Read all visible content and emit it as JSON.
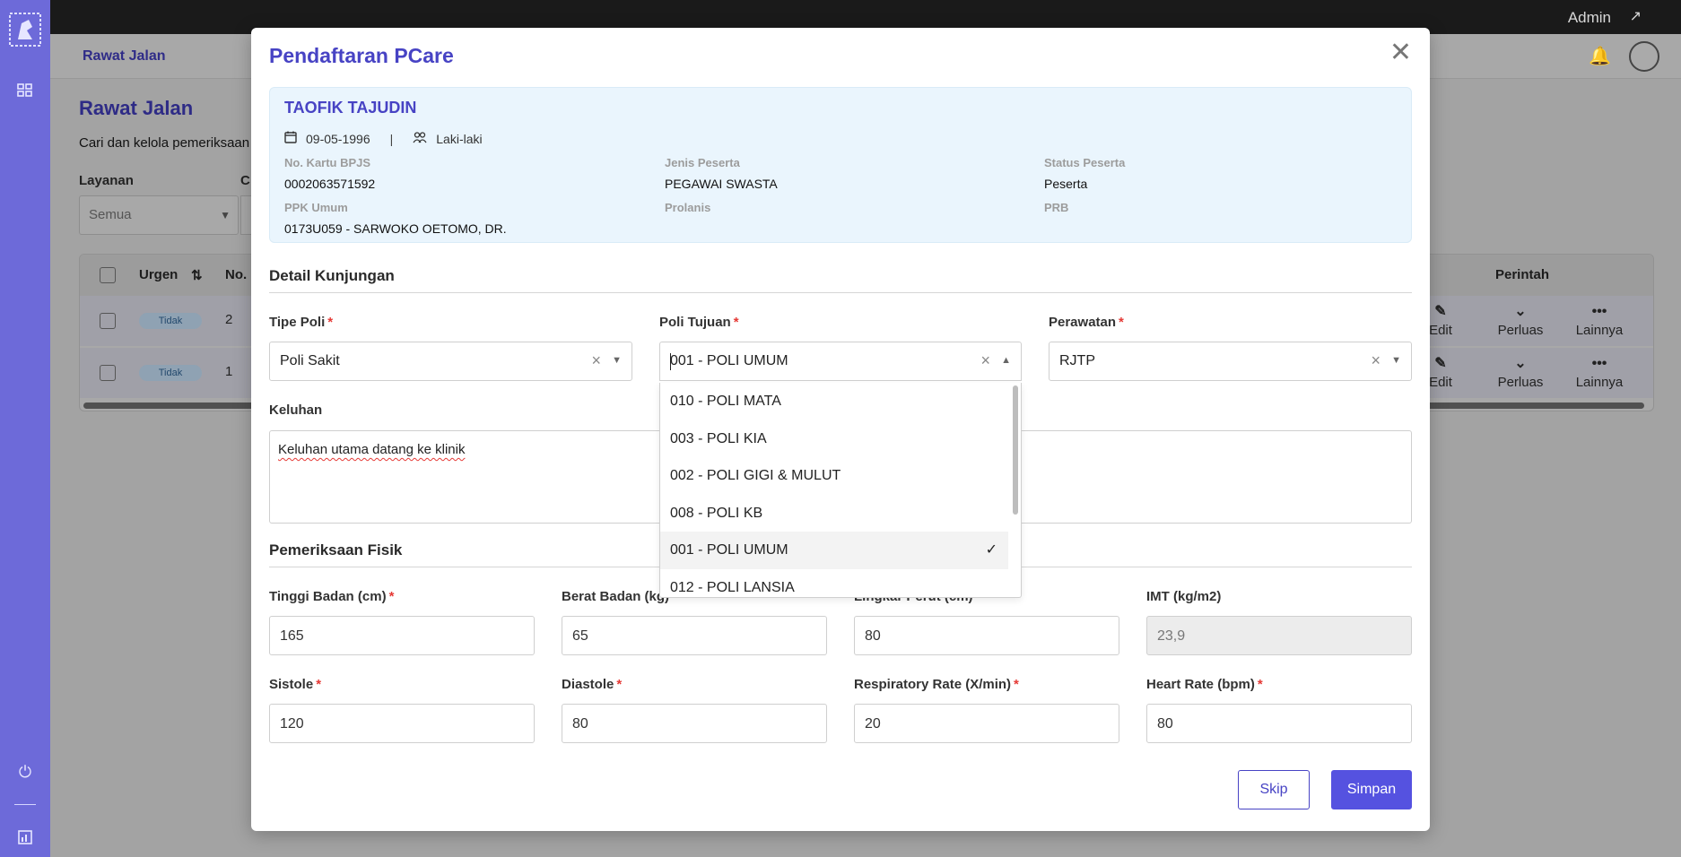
{
  "topbar": {
    "user_label": "Admin"
  },
  "background": {
    "breadcrumb": "Rawat Jalan",
    "page_title": "Rawat Jalan",
    "page_subtitle": "Cari dan kelola pemeriksaan",
    "filter_layanan_label": "Layanan",
    "filter_layanan_value": "Semua",
    "filter_c_label": "C",
    "table": {
      "headers": {
        "urgen": "Urgen",
        "no": "No.",
        "perintah": "Perintah"
      },
      "rows": [
        {
          "urgen": "Tidak",
          "no": "2"
        },
        {
          "urgen": "Tidak",
          "no": "1"
        }
      ],
      "actions": {
        "edit": "Edit",
        "perluas": "Perluas",
        "lainnya": "Lainnya"
      }
    }
  },
  "modal": {
    "title": "Pendaftaran PCare",
    "patient": {
      "name": "TAOFIK TAJUDIN",
      "dob": "09-05-1996",
      "separator": "|",
      "gender": "Laki-laki",
      "fields": [
        {
          "label": "No. Kartu BPJS",
          "value": "0002063571592"
        },
        {
          "label": "Jenis Peserta",
          "value": "PEGAWAI SWASTA"
        },
        {
          "label": "Status Peserta",
          "value": "Peserta"
        },
        {
          "label": "PPK Umum",
          "value": "0173U059 - SARWOKO OETOMO, DR."
        },
        {
          "label": "Prolanis",
          "value": ""
        },
        {
          "label": "PRB",
          "value": ""
        }
      ]
    },
    "detail_section": "Detail Kunjungan",
    "tipe_poli": {
      "label": "Tipe Poli",
      "value": "Poli Sakit"
    },
    "poli_tujuan": {
      "label": "Poli Tujuan",
      "value": "001 - POLI UMUM"
    },
    "perawatan": {
      "label": "Perawatan",
      "value": "RJTP"
    },
    "keluhan": {
      "label": "Keluhan",
      "value": "Keluhan utama datang ke klinik"
    },
    "poli_options": [
      "010 - POLI MATA",
      "003 - POLI KIA",
      "002 - POLI GIGI & MULUT",
      "008 - POLI KB",
      "001 - POLI UMUM",
      "012 - POLI LANSIA"
    ],
    "selected_option": "001 - POLI UMUM",
    "fisik_section": "Pemeriksaan Fisik",
    "fisik": {
      "tinggi": {
        "label": "Tinggi Badan (cm)",
        "value": "165"
      },
      "berat": {
        "label": "Berat Badan (kg)",
        "value": "65"
      },
      "lingkar": {
        "label": "Lingkar Perut (cm)",
        "value": "80"
      },
      "imt": {
        "label": "IMT (kg/m2)",
        "value": "23,9"
      },
      "sistole": {
        "label": "Sistole",
        "value": "120"
      },
      "diastole": {
        "label": "Diastole",
        "value": "80"
      },
      "rr": {
        "label": "Respiratory Rate (X/min)",
        "value": "20"
      },
      "hr": {
        "label": "Heart Rate (bpm)",
        "value": "80"
      }
    },
    "required_mark": "*",
    "buttons": {
      "skip": "Skip",
      "save": "Simpan"
    }
  }
}
